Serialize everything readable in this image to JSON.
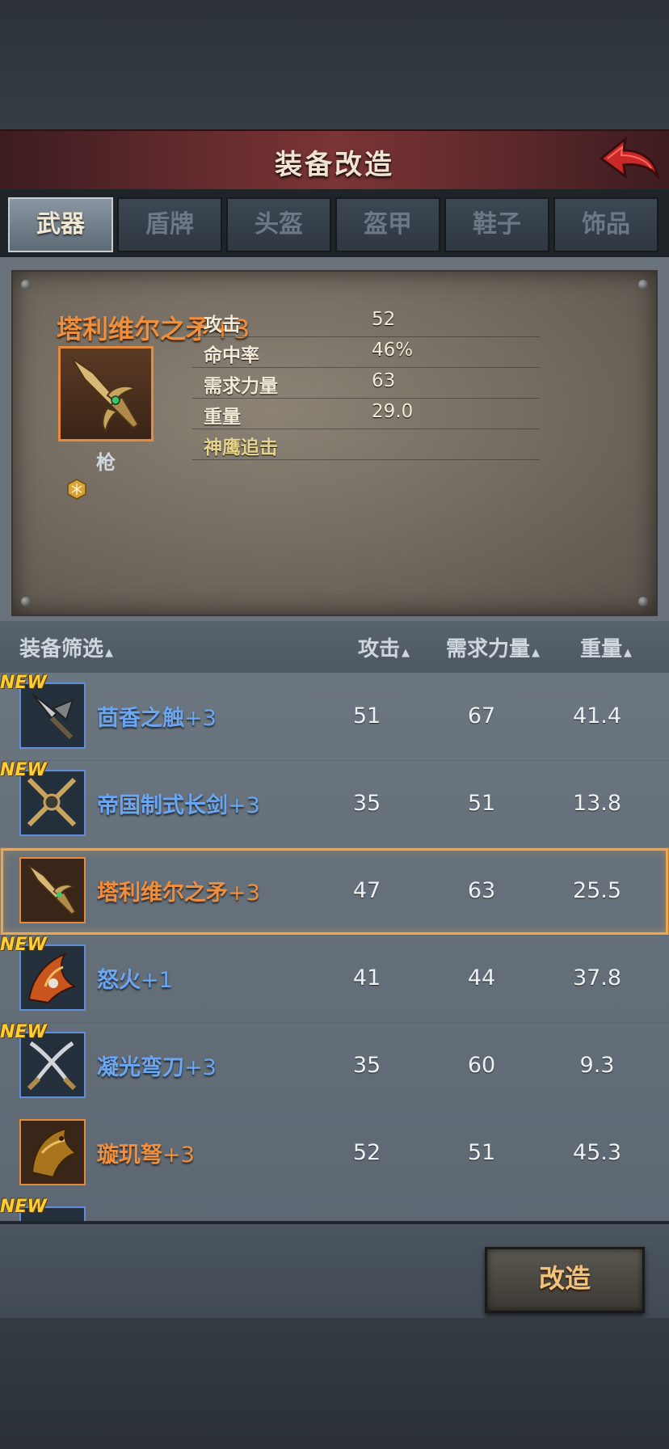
{
  "header": {
    "title": "装备改造"
  },
  "tabs": [
    {
      "label": "武器",
      "active": true
    },
    {
      "label": "盾牌",
      "active": false
    },
    {
      "label": "头盔",
      "active": false
    },
    {
      "label": "盔甲",
      "active": false
    },
    {
      "label": "鞋子",
      "active": false
    },
    {
      "label": "饰品",
      "active": false
    }
  ],
  "detail": {
    "name": "塔利维尔之矛",
    "plus": "+3",
    "type": "枪",
    "icon": "spear-icon",
    "stats": [
      {
        "label": "攻击",
        "value": "52"
      },
      {
        "label": "命中率",
        "value": "46%"
      },
      {
        "label": "需求力量",
        "value": "63"
      },
      {
        "label": "重量",
        "value": "29.0"
      }
    ],
    "skill": "神鹰追击"
  },
  "list": {
    "headers": {
      "filter": "装备筛选",
      "attack": "攻击",
      "strength": "需求力量",
      "weight": "重量"
    },
    "rows": [
      {
        "new": "NEW",
        "name": "茴香之触",
        "plus": "+3",
        "attack": "51",
        "strength": "67",
        "weight": "41.4",
        "rarity": "blue",
        "icon": "mace-icon",
        "selected": false
      },
      {
        "new": "NEW",
        "name": "帝国制式长剑",
        "plus": "+3",
        "attack": "35",
        "strength": "51",
        "weight": "13.8",
        "rarity": "blue",
        "icon": "crossed-swords-icon",
        "selected": false
      },
      {
        "new": "",
        "name": "塔利维尔之矛",
        "plus": "+3",
        "attack": "47",
        "strength": "63",
        "weight": "25.5",
        "rarity": "orange",
        "icon": "spear-icon",
        "selected": true
      },
      {
        "new": "NEW",
        "name": "怒火",
        "plus": "+1",
        "attack": "41",
        "strength": "44",
        "weight": "37.8",
        "rarity": "blue",
        "icon": "fire-claw-icon",
        "selected": false
      },
      {
        "new": "NEW",
        "name": "凝光弯刀",
        "plus": "+3",
        "attack": "35",
        "strength": "60",
        "weight": "9.3",
        "rarity": "blue",
        "icon": "crossed-blades-icon",
        "selected": false
      },
      {
        "new": "",
        "name": "璇玑弩",
        "plus": "+3",
        "attack": "52",
        "strength": "51",
        "weight": "45.3",
        "rarity": "orange",
        "icon": "dragon-crossbow-icon",
        "selected": false
      },
      {
        "new": "NEW",
        "name": "",
        "plus": "",
        "attack": "",
        "strength": "",
        "weight": "",
        "rarity": "blue",
        "icon": "weapon-icon",
        "selected": false
      }
    ]
  },
  "actions": {
    "reforge_label": "改造"
  },
  "colors": {
    "orange": "#f08e3e",
    "blue": "#6aa6f2",
    "highlight": "#f0a64a",
    "header_red": "#6a2e30"
  }
}
